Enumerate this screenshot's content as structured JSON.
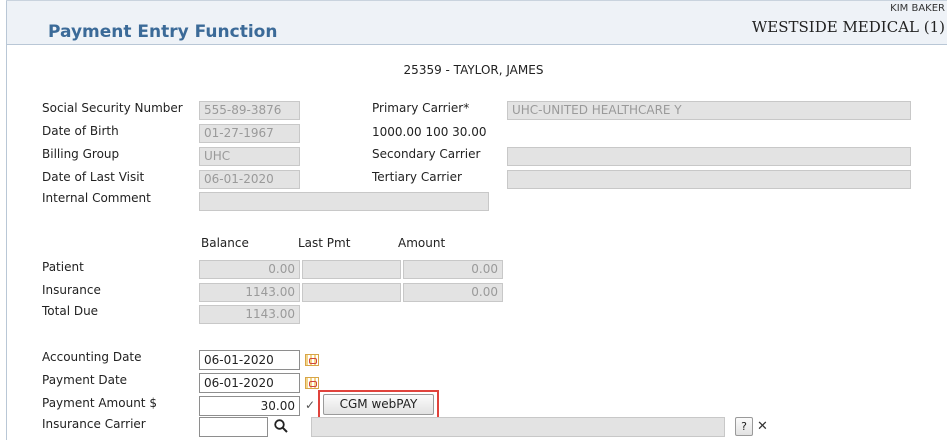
{
  "header": {
    "title": "Payment Entry Function",
    "user": "KIM BAKER",
    "organization": "WESTSIDE MEDICAL (1)"
  },
  "patient_line": "25359 - TAYLOR, JAMES",
  "demographics": {
    "ssn_label": "Social Security Number",
    "ssn_value": "555-89-3876",
    "dob_label": "Date of Birth",
    "dob_value": "01-27-1967",
    "billing_group_label": "Billing Group",
    "billing_group_value": "UHC",
    "last_visit_label": "Date of Last Visit",
    "last_visit_value": "06-01-2020",
    "internal_comment_label": "Internal Comment",
    "internal_comment_value": ""
  },
  "carriers": {
    "primary_label": "Primary Carrier*",
    "primary_value": "UHC-UNITED HEALTHCARE Y",
    "primary_details": "1000.00  100  30.00",
    "secondary_label": "Secondary Carrier",
    "secondary_value": "",
    "tertiary_label": "Tertiary Carrier",
    "tertiary_value": ""
  },
  "balances": {
    "columns": [
      "Balance",
      "Last Pmt",
      "Amount"
    ],
    "rows": [
      {
        "label": "Patient",
        "balance": "0.00",
        "last_pmt": "",
        "amount": "0.00"
      },
      {
        "label": "Insurance",
        "balance": "1143.00",
        "last_pmt": "",
        "amount": "0.00"
      },
      {
        "label": "Total Due",
        "balance": "1143.00"
      }
    ]
  },
  "payment": {
    "accounting_date_label": "Accounting Date",
    "accounting_date_value": "06-01-2020",
    "payment_date_label": "Payment Date",
    "payment_date_value": "06-01-2020",
    "amount_label": "Payment Amount $",
    "amount_value": "30.00",
    "check_mark": "✓",
    "webpay_label": "CGM webPAY",
    "insurance_carrier_label": "Insurance Carrier",
    "insurance_carrier_value": "",
    "insurance_carrier_name": "",
    "search_icon": "🔍",
    "help_label": "?",
    "clear_label": "✕"
  },
  "colors": {
    "title": "#3b6a98",
    "header_bg": "#eef2f7",
    "highlight": "#e0433c",
    "readonly_bg": "#e3e3e3"
  }
}
